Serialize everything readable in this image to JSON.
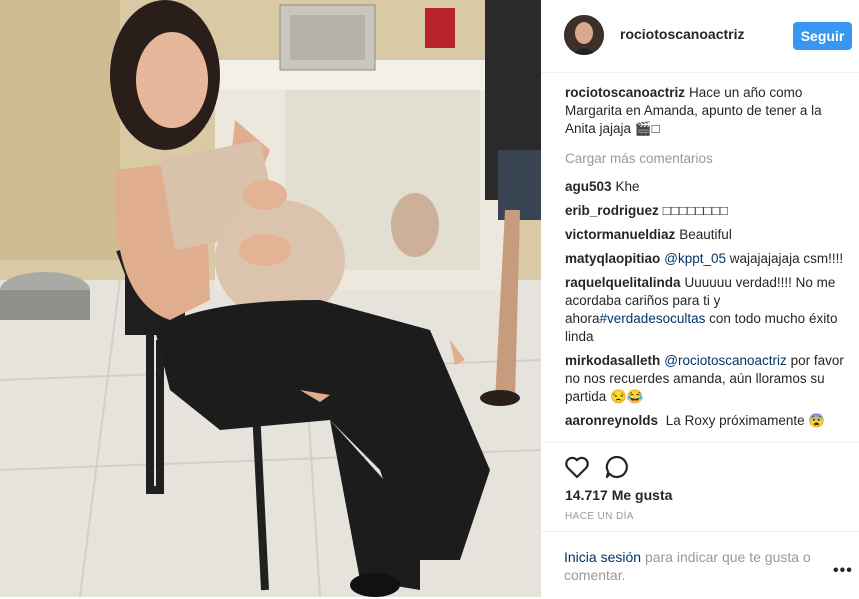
{
  "post": {
    "username": "rociotoscanoactriz",
    "follow_label": "Seguir",
    "caption": {
      "user": "rociotoscanoactriz",
      "text": "Hace un año como Margarita en Amanda, apunto de tener a la Anita jajaja 🎬□"
    },
    "load_more": "Cargar más comentarios",
    "comments": [
      {
        "user": "agu503",
        "text": "Khe"
      },
      {
        "user": "erib_rodriguez",
        "text": "□□□□□□□□"
      },
      {
        "user": "victormanueldiaz",
        "text": "Beautiful"
      },
      {
        "user": "matyqlaopitiao",
        "mention": "@kppt_05",
        "text": "wajajajajaja csm!!!!"
      },
      {
        "user": "raquelquelitalinda",
        "text": "Uuuuuu verdad!!!! No me acordaba cariños para ti y ahora",
        "tag": "#verdadesocultas",
        "text2": "con todo mucho éxito linda"
      },
      {
        "user": "mirkodasalleth",
        "mention": "@rociotoscanoactriz",
        "text": "por favor no nos recuerdes amanda, aún lloramos su partida 😒😂"
      },
      {
        "user": "aaronreynolds",
        "text": "La Roxy próximamente 😨"
      }
    ],
    "likes": "14.717 Me gusta",
    "time_ago": "HACE UN DÍA",
    "login": {
      "link": "Inicia sesión",
      "text": "para indicar que te gusta o comentar."
    },
    "more_options": "•••"
  },
  "icons": {
    "like": "heart-outline-icon",
    "comment": "comment-bubble-icon"
  },
  "colors": {
    "follow_button": "#3897f0",
    "link": "#003569",
    "muted": "#999999"
  }
}
